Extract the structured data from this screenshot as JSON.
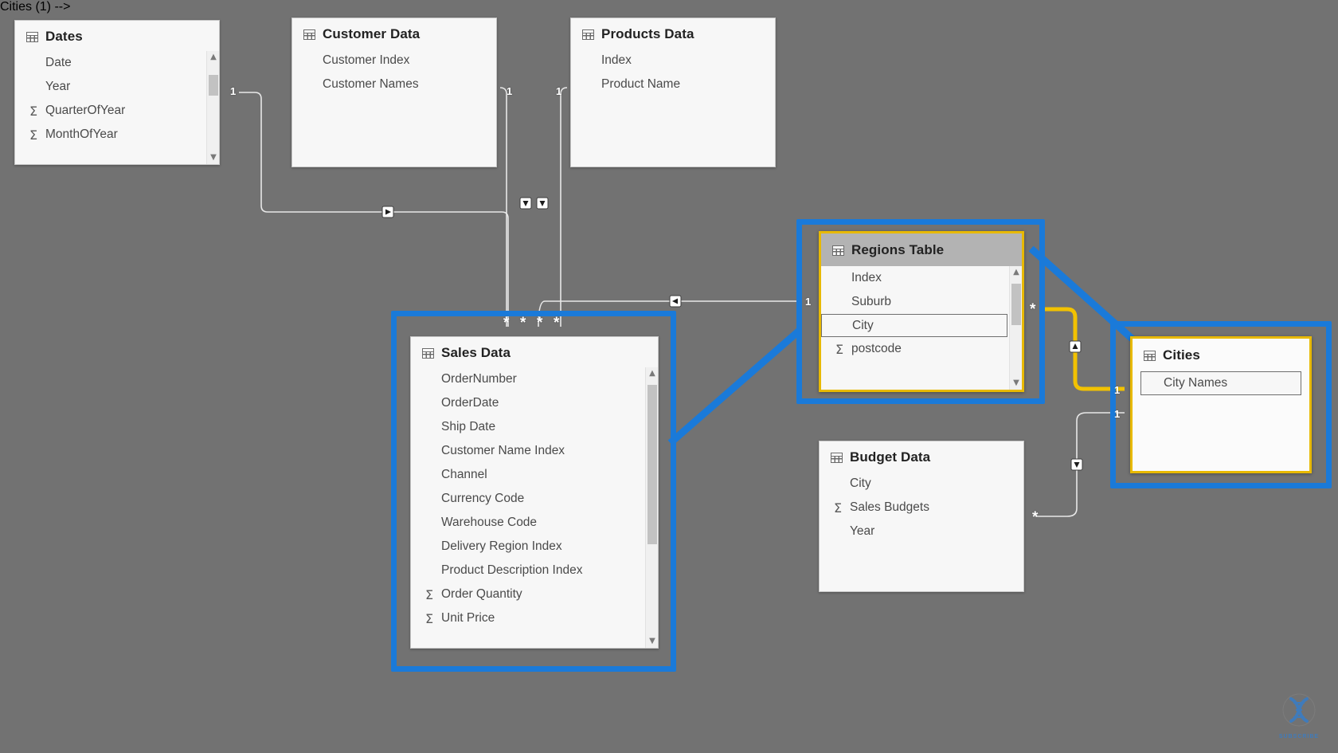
{
  "app": {
    "view_name": "Model view",
    "canvas_bg": "#727272",
    "accent_blue": "#1a7ad9",
    "accent_gold": "#e8b900"
  },
  "tables": [
    {
      "id": "dates",
      "name": "Dates",
      "icon": "table-grid-icon",
      "selected": false,
      "has_scrollbar": true,
      "fields": [
        {
          "label": "Date",
          "aggregate": false,
          "highlighted": false
        },
        {
          "label": "Year",
          "aggregate": false,
          "highlighted": false
        },
        {
          "label": "QuarterOfYear",
          "aggregate": true,
          "highlighted": false
        },
        {
          "label": "MonthOfYear",
          "aggregate": true,
          "highlighted": false
        }
      ]
    },
    {
      "id": "customer-data",
      "name": "Customer Data",
      "icon": "table-grid-icon",
      "selected": false,
      "has_scrollbar": false,
      "fields": [
        {
          "label": "Customer Index",
          "aggregate": false,
          "highlighted": false
        },
        {
          "label": "Customer Names",
          "aggregate": false,
          "highlighted": false
        }
      ]
    },
    {
      "id": "products-data",
      "name": "Products Data",
      "icon": "table-grid-icon",
      "selected": false,
      "has_scrollbar": false,
      "fields": [
        {
          "label": "Index",
          "aggregate": false,
          "highlighted": false
        },
        {
          "label": "Product Name",
          "aggregate": false,
          "highlighted": false
        }
      ]
    },
    {
      "id": "regions-table",
      "name": "Regions Table",
      "icon": "table-grid-icon",
      "selected": true,
      "has_scrollbar": true,
      "fields": [
        {
          "label": "Index",
          "aggregate": false,
          "highlighted": false
        },
        {
          "label": "Suburb",
          "aggregate": false,
          "highlighted": false
        },
        {
          "label": "City",
          "aggregate": false,
          "highlighted": true
        },
        {
          "label": "postcode",
          "aggregate": true,
          "highlighted": false
        }
      ]
    },
    {
      "id": "sales-data",
      "name": "Sales Data",
      "icon": "table-grid-icon",
      "selected": false,
      "has_scrollbar": true,
      "fields": [
        {
          "label": "OrderNumber",
          "aggregate": false,
          "highlighted": false
        },
        {
          "label": "OrderDate",
          "aggregate": false,
          "highlighted": false
        },
        {
          "label": "Ship Date",
          "aggregate": false,
          "highlighted": false
        },
        {
          "label": "Customer Name Index",
          "aggregate": false,
          "highlighted": false
        },
        {
          "label": "Channel",
          "aggregate": false,
          "highlighted": false
        },
        {
          "label": "Currency Code",
          "aggregate": false,
          "highlighted": false
        },
        {
          "label": "Warehouse Code",
          "aggregate": false,
          "highlighted": false
        },
        {
          "label": "Delivery Region Index",
          "aggregate": false,
          "highlighted": false
        },
        {
          "label": "Product Description Index",
          "aggregate": false,
          "highlighted": false
        },
        {
          "label": "Order Quantity",
          "aggregate": true,
          "highlighted": false
        },
        {
          "label": "Unit Price",
          "aggregate": true,
          "highlighted": false
        }
      ]
    },
    {
      "id": "budget-data",
      "name": "Budget Data",
      "icon": "table-grid-icon",
      "selected": false,
      "has_scrollbar": false,
      "fields": [
        {
          "label": "City",
          "aggregate": false,
          "highlighted": false
        },
        {
          "label": "Sales Budgets",
          "aggregate": true,
          "highlighted": false
        },
        {
          "label": "Year",
          "aggregate": false,
          "highlighted": false
        }
      ]
    },
    {
      "id": "cities",
      "name": "Cities",
      "icon": "table-grid-icon",
      "selected": true,
      "has_scrollbar": false,
      "fields": [
        {
          "label": "City Names",
          "aggregate": false,
          "highlighted": true
        }
      ]
    }
  ],
  "cardinality_labels": [
    {
      "id": "dates-one",
      "text": "1"
    },
    {
      "id": "customer-one",
      "text": "1"
    },
    {
      "id": "products-one",
      "text": "1"
    },
    {
      "id": "regions-one",
      "text": "1"
    },
    {
      "id": "regions-star",
      "text": "*"
    },
    {
      "id": "cities-one-upper",
      "text": "1"
    },
    {
      "id": "cities-one-lower",
      "text": "1"
    },
    {
      "id": "budget-star",
      "text": "*"
    },
    {
      "id": "sales-star-1",
      "text": "*"
    },
    {
      "id": "sales-star-2",
      "text": "*"
    },
    {
      "id": "sales-star-3",
      "text": "*"
    },
    {
      "id": "sales-star-4",
      "text": "*"
    }
  ],
  "annotations": [
    {
      "id": "anno-regions",
      "shape": "rectangle",
      "color": "#1a7ad9"
    },
    {
      "id": "anno-sales",
      "shape": "rectangle",
      "color": "#1a7ad9"
    },
    {
      "id": "anno-cities",
      "shape": "rectangle",
      "color": "#1a7ad9"
    },
    {
      "id": "anno-line-sales-regions",
      "shape": "line",
      "color": "#1a7ad9"
    },
    {
      "id": "anno-line-regions-cities",
      "shape": "line",
      "color": "#1a7ad9"
    }
  ],
  "relationship_highlight": {
    "id": "regions-cities-relationship",
    "color": "#f2c200",
    "from": "Regions Table",
    "to": "Cities"
  },
  "watermark": {
    "label": "SUBSCRIBE",
    "icon": "dna-helix-icon"
  }
}
